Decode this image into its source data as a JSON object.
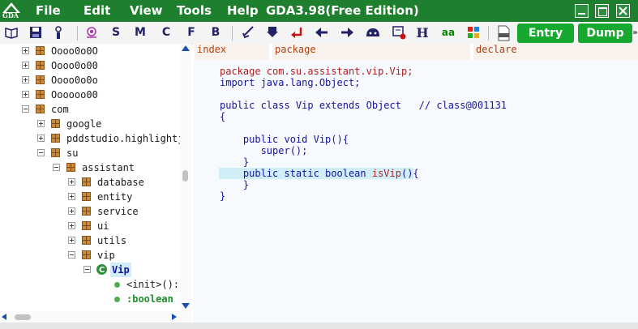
{
  "app": {
    "title": "GDA3.98(Free Edition)",
    "logo_text": "GDA"
  },
  "menu": [
    "File",
    "Edit",
    "View",
    "Tools",
    "Help"
  ],
  "toolbar": {
    "letters": [
      "S",
      "M",
      "C",
      "F",
      "B"
    ],
    "h_label": "H",
    "aa_label": "aa",
    "entry_label": "Entry",
    "dump_label": "Dump"
  },
  "tree": {
    "items": [
      {
        "label": "Oooo0o0O"
      },
      {
        "label": "Oooo0o00"
      },
      {
        "label": "Oooo0o0o"
      },
      {
        "label": "Oooooo00"
      },
      {
        "label": "com"
      },
      {
        "label": "google"
      },
      {
        "label": "pddstudio.highlightj"
      },
      {
        "label": "su"
      },
      {
        "label": "assistant"
      },
      {
        "label": "database"
      },
      {
        "label": "entity"
      },
      {
        "label": "service"
      },
      {
        "label": "ui"
      },
      {
        "label": "utils"
      },
      {
        "label": "vip"
      },
      {
        "label": "Vip"
      },
      {
        "label": "<init>():"
      },
      {
        "label": ":boolean"
      }
    ]
  },
  "tabs": [
    "index",
    "package",
    "declare"
  ],
  "code": {
    "line1_kw": "package",
    "line1_rest": " com.su.assistant.vip.Vip;",
    "line2_kw": "import",
    "line2_rest": " java.lang.Object;",
    "line3_a": "public class",
    "line3_b": " Vip ",
    "line3_c": "extends",
    "line3_d": " Object",
    "line3_comment": "   // class@001131",
    "brace_open": "{",
    "line5_a": "    public void",
    "line5_b": " Vip(){",
    "line6": "       super();",
    "brace_close_inner": "    }",
    "line8_a": "    public static",
    "line8_b": " boolean ",
    "line8_c": "isVip",
    "line8_d": "(){",
    "brace_close_inner2": "    }",
    "brace_close": "}"
  },
  "colors": {
    "titlebar": "#1e7f2e",
    "accent_button": "#16a82f",
    "keyword": "#1414a0",
    "string_red": "#b02020"
  }
}
